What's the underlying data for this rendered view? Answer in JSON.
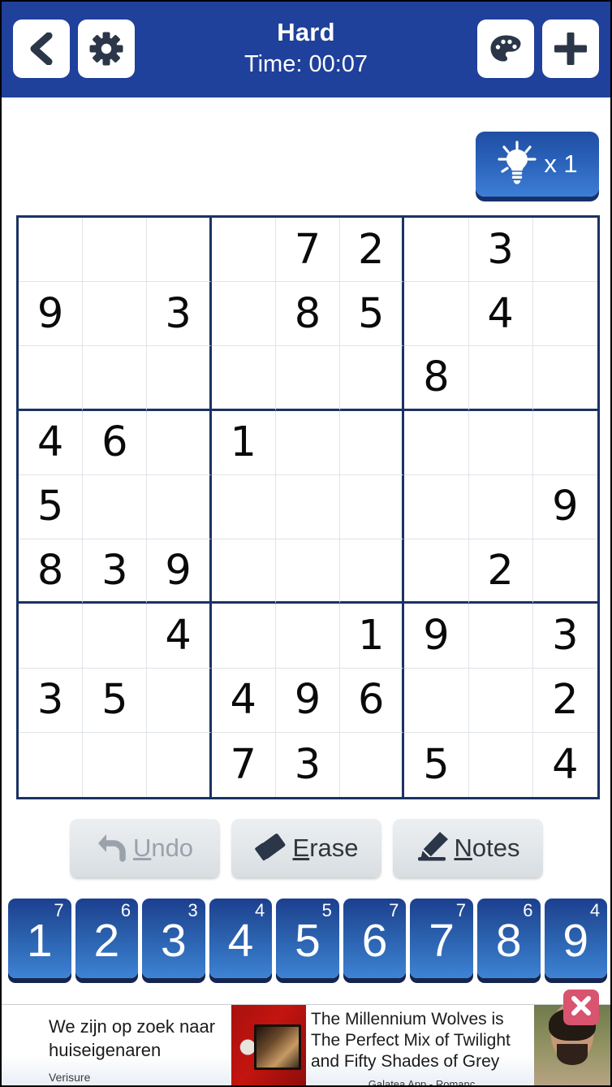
{
  "header": {
    "title": "Hard",
    "time_label": "Time: 00:07",
    "back_icon": "back-chevron-icon",
    "settings_icon": "gear-icon",
    "theme_icon": "palette-icon",
    "add_icon": "plus-icon",
    "background_color": "#1f409b"
  },
  "hint": {
    "icon": "lightbulb-icon",
    "count_label": "x 1"
  },
  "board": {
    "rows": [
      [
        "",
        "",
        "",
        "",
        "7",
        "2",
        "",
        "3",
        ""
      ],
      [
        "9",
        "",
        "3",
        "",
        "8",
        "5",
        "",
        "4",
        ""
      ],
      [
        "",
        "",
        "",
        "",
        "",
        "",
        "8",
        "",
        ""
      ],
      [
        "4",
        "6",
        "",
        "1",
        "",
        "",
        "",
        "",
        ""
      ],
      [
        "5",
        "",
        "",
        "",
        "",
        "",
        "",
        "",
        "9"
      ],
      [
        "8",
        "3",
        "9",
        "",
        "",
        "",
        "",
        "2",
        ""
      ],
      [
        "",
        "",
        "4",
        "",
        "",
        "1",
        "9",
        "",
        "3"
      ],
      [
        "3",
        "5",
        "",
        "4",
        "9",
        "6",
        "",
        "",
        "2"
      ],
      [
        "",
        "",
        "",
        "7",
        "3",
        "",
        "5",
        "",
        "4"
      ]
    ],
    "border_color": "#1b3263",
    "cell_line_color": "#dfe3e9"
  },
  "actions": [
    {
      "label": "Undo",
      "accel": "U",
      "rest": "ndo",
      "icon": "undo-arrow-icon",
      "disabled": true
    },
    {
      "label": "Erase",
      "accel": "E",
      "rest": "rase",
      "icon": "eraser-icon",
      "disabled": false
    },
    {
      "label": "Notes",
      "accel": "N",
      "rest": "otes",
      "icon": "pencil-icon",
      "disabled": false
    }
  ],
  "numpad": [
    {
      "digit": "1",
      "count": "7"
    },
    {
      "digit": "2",
      "count": "6"
    },
    {
      "digit": "3",
      "count": "3"
    },
    {
      "digit": "4",
      "count": "4"
    },
    {
      "digit": "5",
      "count": "5"
    },
    {
      "digit": "6",
      "count": "7"
    },
    {
      "digit": "7",
      "count": "7"
    },
    {
      "digit": "8",
      "count": "6"
    },
    {
      "digit": "9",
      "count": "4"
    }
  ],
  "ads": {
    "ad1": {
      "headline": "We zijn op zoek naar huiseigenaren",
      "advertiser": "Verisure"
    },
    "ad2": {
      "headline": "The Millennium Wolves is The Perfect Mix of Twilight and Fifty Shades of Grey",
      "advertiser": "Galatea App - Romanc"
    },
    "close_icon": "close-x-icon",
    "close_color": "#d8546f"
  }
}
